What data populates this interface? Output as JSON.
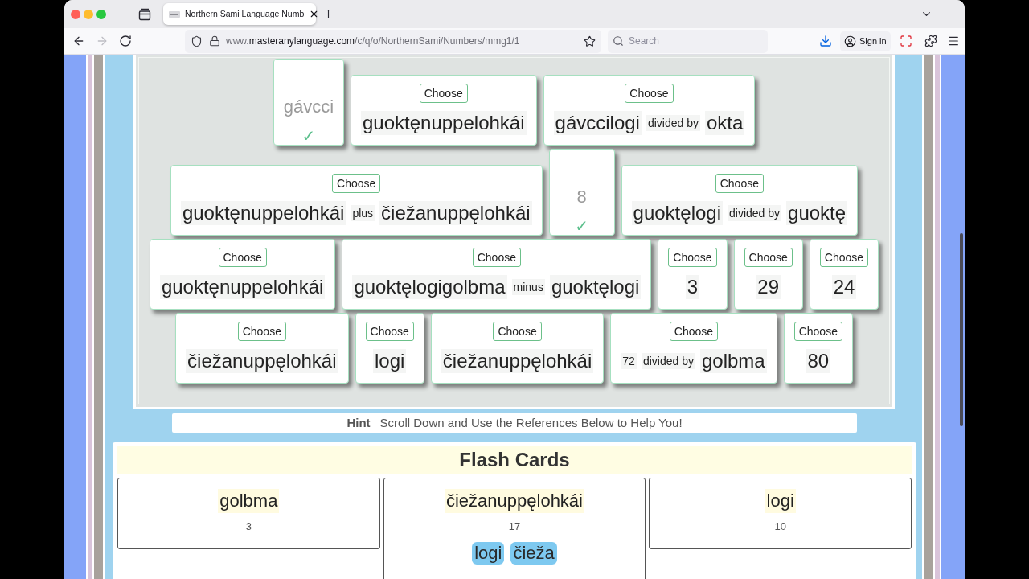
{
  "browser": {
    "tabs": [
      {
        "title": "Northern Sami Language Numb",
        "selected": true
      }
    ],
    "nav": [
      {
        "kind": "back",
        "disabled": false
      },
      {
        "kind": "forward",
        "disabled": true
      },
      {
        "kind": "reload",
        "disabled": false
      }
    ],
    "url": {
      "prefix": "www.",
      "domain": "masteranylanguage.com",
      "path": "/c/q/o/NorthernSami/Numbers/mmg1/1"
    },
    "search": {
      "placeholder": "Search"
    },
    "sign_in": "Sign in"
  },
  "game": {
    "rows": [
      [
        {
          "kind": "answered",
          "mark": "✓",
          "parts": [
            {
              "text": "gávcci",
              "small": false
            }
          ]
        },
        {
          "kind": "choice",
          "button": "Choose",
          "parts": [
            {
              "text": "guoktęnuppelohkái",
              "small": false
            }
          ]
        },
        {
          "kind": "choice",
          "button": "Choose",
          "parts": [
            {
              "text": "gávccilogi",
              "small": false
            },
            {
              "text": "divided by",
              "small": true
            },
            {
              "text": "okta",
              "small": false
            }
          ]
        }
      ],
      [
        {
          "kind": "choice",
          "button": "Choose",
          "parts": [
            {
              "text": "guoktęnuppelohkái",
              "small": false
            },
            {
              "text": "plus",
              "small": true
            },
            {
              "text": "čiežanuppęlohkái",
              "small": false
            }
          ]
        },
        {
          "kind": "answered",
          "mark": "✓",
          "parts": [
            {
              "text": "8",
              "small": false
            }
          ]
        },
        {
          "kind": "choice",
          "button": "Choose",
          "parts": [
            {
              "text": "guoktęlogi",
              "small": false
            },
            {
              "text": "divided by",
              "small": true
            },
            {
              "text": "guoktę",
              "small": false
            }
          ]
        }
      ],
      [
        {
          "kind": "choice",
          "button": "Choose",
          "parts": [
            {
              "text": "guoktęnuppelohkái",
              "small": false
            }
          ]
        },
        {
          "kind": "choice",
          "button": "Choose",
          "parts": [
            {
              "text": "guoktęlogigolbma",
              "small": false
            },
            {
              "text": "minus",
              "small": true
            },
            {
              "text": "guoktęlogi",
              "small": false
            }
          ]
        },
        {
          "kind": "choice",
          "button": "Choose",
          "parts": [
            {
              "text": "3",
              "small": false
            }
          ]
        },
        {
          "kind": "choice",
          "button": "Choose",
          "parts": [
            {
              "text": "29",
              "small": false
            }
          ]
        },
        {
          "kind": "choice",
          "button": "Choose",
          "parts": [
            {
              "text": "24",
              "small": false
            }
          ]
        }
      ],
      [
        {
          "kind": "choice",
          "button": "Choose",
          "parts": [
            {
              "text": "čiežanuppęlohkái",
              "small": false
            }
          ]
        },
        {
          "kind": "choice",
          "button": "Choose",
          "parts": [
            {
              "text": "logi",
              "small": false
            }
          ]
        },
        {
          "kind": "choice",
          "button": "Choose",
          "parts": [
            {
              "text": "čiežanuppęlohkái",
              "small": false
            }
          ]
        },
        {
          "kind": "choice",
          "button": "Choose",
          "parts": [
            {
              "text": "72",
              "small": true
            },
            {
              "text": "divided by",
              "small": true
            },
            {
              "text": "golbma",
              "small": false
            }
          ]
        },
        {
          "kind": "choice",
          "button": "Choose",
          "parts": [
            {
              "text": "80",
              "small": false
            }
          ]
        }
      ]
    ]
  },
  "hint": {
    "label": "Hint",
    "text": "Scroll Down and Use the References Below to Help You!"
  },
  "flash_cards": {
    "title": "Flash Cards",
    "cards": [
      {
        "word": "golbma",
        "value": "3"
      },
      {
        "word": "čiežanuppęlohkái",
        "value": "17",
        "tags": [
          "logi",
          "čieža"
        ]
      },
      {
        "word": "logi",
        "value": "10"
      }
    ]
  }
}
